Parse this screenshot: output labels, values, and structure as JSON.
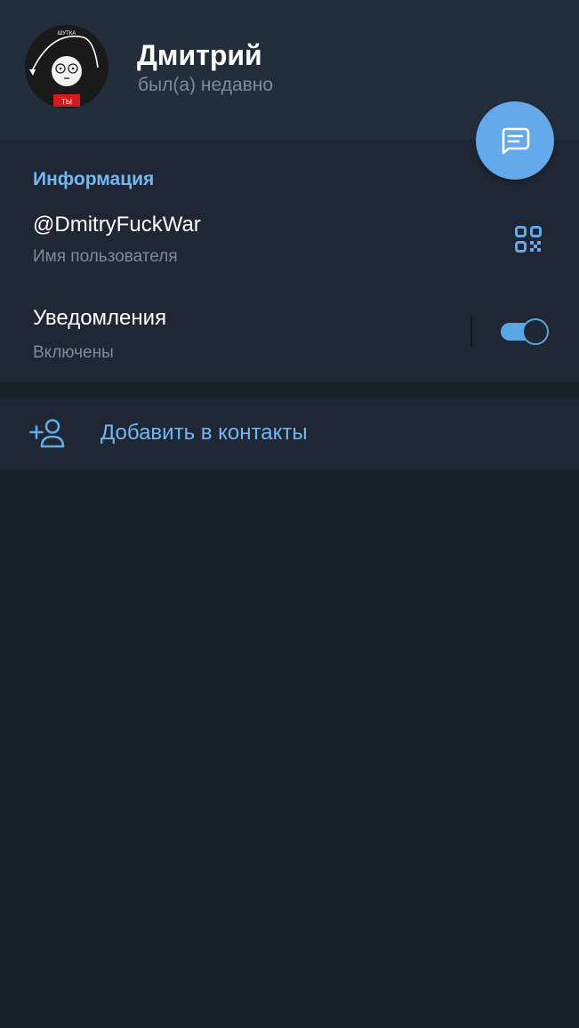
{
  "profile": {
    "name": "Дмитрий",
    "status": "был(а) недавно",
    "avatar": {
      "top_text": "ШУТКА",
      "badge_text": "ТЫ",
      "icon": "avatar-image"
    }
  },
  "fab": {
    "icon": "message-icon"
  },
  "info_section": {
    "title": "Информация",
    "username": {
      "value": "@DmitryFuckWar",
      "label": "Имя пользователя",
      "icon": "qr-code-icon"
    },
    "notifications": {
      "title": "Уведомления",
      "status": "Включены",
      "enabled": true
    }
  },
  "add_contact": {
    "label": "Добавить в контакты",
    "icon": "add-user-icon"
  },
  "colors": {
    "background": "#18202a",
    "header": "#232e3c",
    "section": "#1e2733",
    "accent": "#64a9e9",
    "accent_text": "#71b7f2",
    "secondary_text": "#7e8b99",
    "primary_text": "#ffffff"
  }
}
